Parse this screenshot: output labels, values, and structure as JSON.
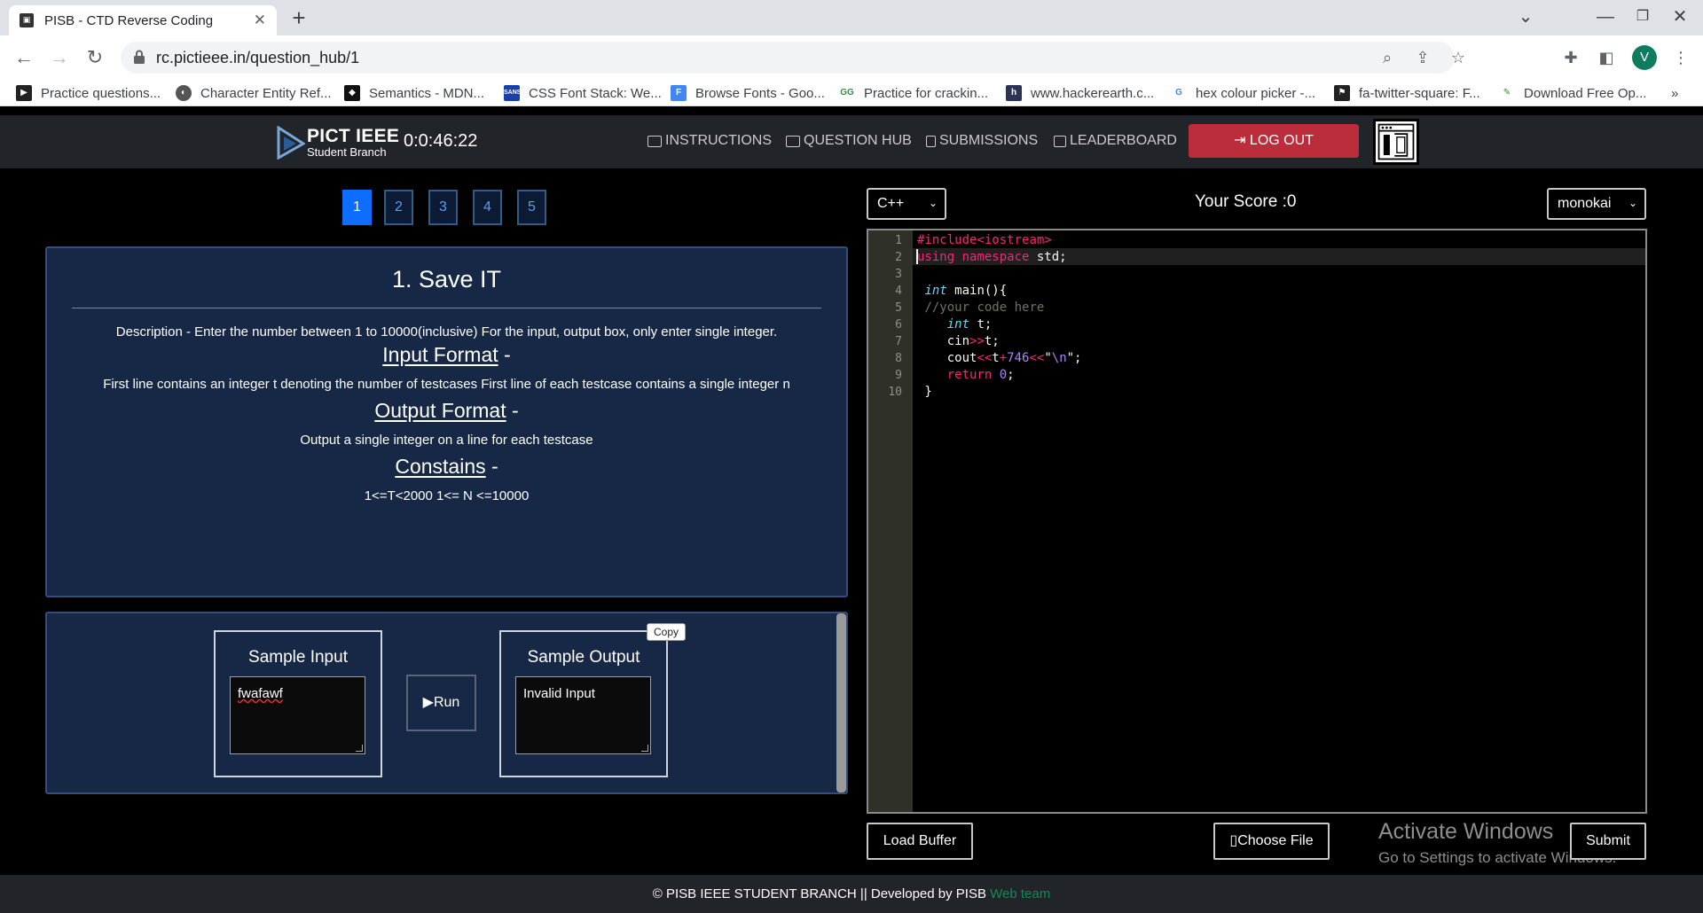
{
  "browser": {
    "tab_title": "PISB - CTD Reverse Coding",
    "url": "rc.pictieee.in/question_hub/1",
    "profile_initial": "V",
    "bookmarks": [
      "Practice questions...",
      "Character Entity Ref...",
      "Semantics - MDN...",
      "CSS Font Stack: We...",
      "Browse Fonts - Goo...",
      "Practice for crackin...",
      "www.hackerearth.c...",
      "hex colour picker -...",
      "fa-twitter-square: F...",
      "Download Free Op..."
    ],
    "bookmarks_overflow": "»"
  },
  "header": {
    "brand_title": "PICT IEEE",
    "brand_subtitle": "Student Branch",
    "timer": "0:0:46:22",
    "nav": [
      "INSTRUCTIONS",
      "QUESTION HUB",
      "SUBMISSIONS",
      "LEADERBOARD"
    ],
    "logout": "LOG OUT"
  },
  "questions": {
    "numbers": [
      "1",
      "2",
      "3",
      "4",
      "5"
    ],
    "active": "1"
  },
  "question": {
    "title": "1. Save IT",
    "description": "Description - Enter the number between 1 to 10000(inclusive) For the input, output box, only enter single integer.",
    "input_format_label": "Input Format",
    "input_format": "First line contains an integer t denoting the number of testcases First line of each testcase contains a single integer n",
    "output_format_label": "Output Format",
    "output_format": "Output a single integer on a line for each testcase",
    "constraints_label": "Constains",
    "constraints": "1<=T<2000 1<= N <=10000",
    "dash": "-"
  },
  "samples": {
    "input_label": "Sample Input",
    "input_value": "fwafawf",
    "run_label": "Run",
    "output_label": "Sample Output",
    "output_value": "Invalid Input",
    "copy_label": "Copy"
  },
  "editor": {
    "language": "C++",
    "score_label": "Your Score :0",
    "theme": "monokai",
    "line_numbers": [
      "1",
      "2",
      "3",
      "4",
      "5",
      "6",
      "7",
      "8",
      "9",
      "10"
    ]
  },
  "actions": {
    "load_buffer": "Load Buffer",
    "choose_file": "Choose File",
    "submit": "Submit"
  },
  "watermark": {
    "line1": "Activate Windows",
    "line2": "Go to Settings to activate Windows."
  },
  "footer": {
    "text": "© PISB IEEE STUDENT BRANCH || Developed by PISB ",
    "link": "Web team"
  }
}
